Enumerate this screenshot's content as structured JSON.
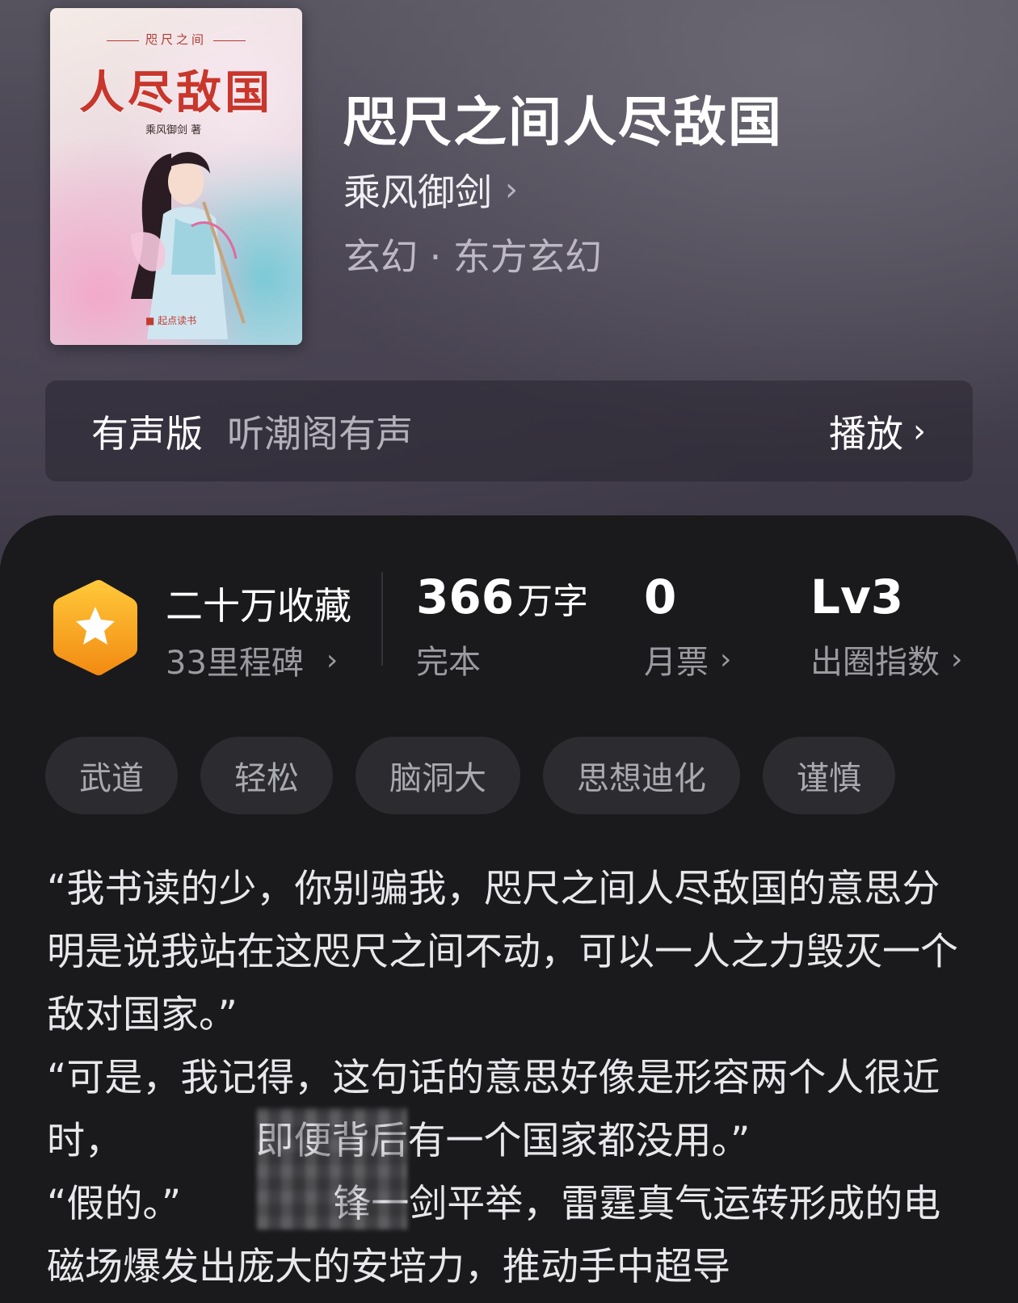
{
  "book": {
    "cover_top": "咫尺之间",
    "cover_title": "人尽敌国",
    "cover_author": "乘风御剑 著",
    "title": "咫尺之间人尽敌国",
    "author": "乘风御剑",
    "genre": "玄幻 · 东方玄幻"
  },
  "audio": {
    "label": "有声版",
    "source": "听潮阁有声",
    "play_label": "播放"
  },
  "stats": {
    "favorites_main": "二十万收藏",
    "favorites_sub": "33里程碑",
    "words_num": "366",
    "words_unit": "万字",
    "words_label": "完本",
    "tickets_num": "0",
    "tickets_label": "月票",
    "level_num": "Lv3",
    "level_label": "出圈指数"
  },
  "tags": [
    "武道",
    "轻松",
    "脑洞大",
    "思想迪化",
    "谨慎"
  ],
  "synopsis": [
    "“我书读的少，你别骗我，咫尺之间人尽敌国的意思分明是说我站在这咫尺之间不动，可以一人之力毁灭一个敌对国家。”",
    "“可是，我记得，这句话的意思好像是形容两个人很近时，　　　　即便背后有一个国家都没用。”",
    "“假的。”　　　　锋一剑平举，雷霆真气运转形成的电磁场爆发出庞大的安培力，推动手中超导"
  ],
  "colors": {
    "background": "#1a1a1c",
    "tag_bg": "#2c2c30",
    "muted_text": "#9a9aa0",
    "hex_orange": "#f6a21c"
  },
  "icons": {
    "favorites": "star-hexagon-icon",
    "chevron": "chevron-right-icon"
  }
}
